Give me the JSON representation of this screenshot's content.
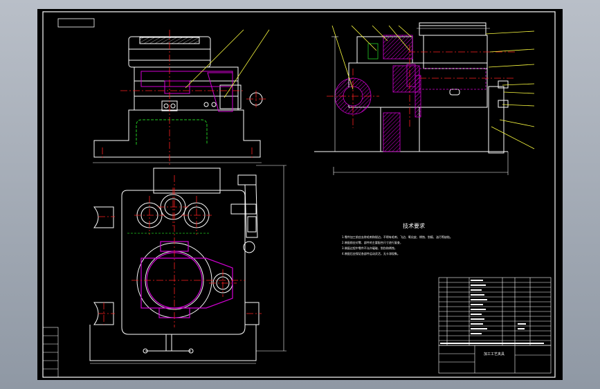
{
  "drawing": {
    "tech_title": "技术要求",
    "requirements": [
      "1.零件加工前应去除毛刺和锐边，不得有毛刺、飞边、氧化皮、锈蚀、划痕、油污等缺陷。",
      "2.装配前应对零、部件的主要配合尺寸进行复查，",
      "3.装配过程中零件不允许磕碰、划伤和锈蚀，",
      "4.装配后应保证各部件运动灵活，无卡滞现象。"
    ],
    "title_block_name": "加工工艺夹具"
  },
  "colors": {
    "outline": "#ffffff",
    "centerline": "#ff2020",
    "hidden": "#22cc22",
    "section_hatch": "#d400d4",
    "leader": "#ffff40"
  }
}
